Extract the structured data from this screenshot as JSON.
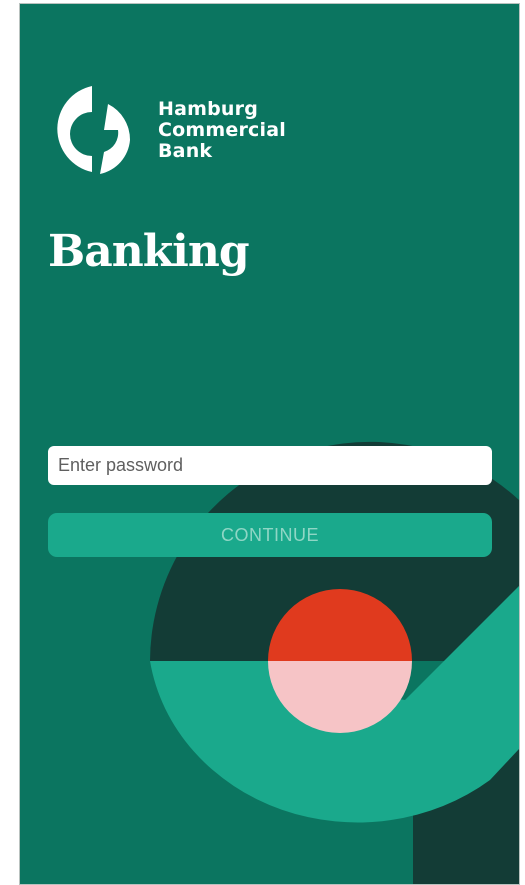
{
  "brand": {
    "name_lines": [
      "Hamburg",
      "Commercial",
      "Bank"
    ],
    "logo_icon": "hcob-logo-icon"
  },
  "page": {
    "title": "Banking"
  },
  "login": {
    "password_placeholder": "Enter password",
    "continue_label": "CONTINUE"
  },
  "colors": {
    "background": "#0b7560",
    "dark_shape": "#133c36",
    "accent_teal": "#1aa98c",
    "red": "#e03a1e",
    "pink": "#f6c4c6",
    "white": "#ffffff"
  }
}
